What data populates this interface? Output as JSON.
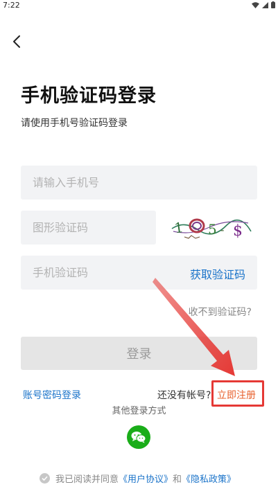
{
  "status_bar": {
    "time": "7:22"
  },
  "header": {
    "title": "手机验证码登录",
    "subtitle": "请使用手机号验证码登录"
  },
  "form": {
    "phone_placeholder": "请输入手机号",
    "captcha_placeholder": "图形验证码",
    "sms_placeholder": "手机验证码",
    "get_code_label": "获取验证码",
    "no_code_label": "收不到验证码?",
    "login_label": "登录"
  },
  "footer": {
    "password_login_label": "账号密码登录",
    "no_account_label": "还没有帐号?",
    "register_label": "立即注册",
    "other_login_label": "其他登录方式",
    "agreement_prefix": "我已阅读并同意",
    "user_agreement": "《用户协议》",
    "and_text": "和",
    "privacy_policy": "《隐私政策》"
  },
  "colors": {
    "link_blue": "#1a73c9",
    "register_orange": "#e8602c",
    "annotation_red": "#e53935",
    "wechat_green": "#1aad19"
  },
  "icons": {
    "back": "chevron-left-icon",
    "wechat": "wechat-icon",
    "check": "check-circle-icon"
  }
}
